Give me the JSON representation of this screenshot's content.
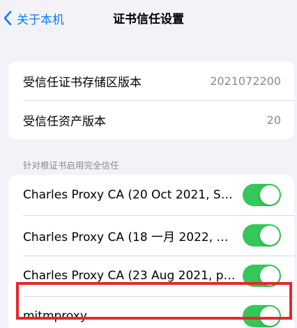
{
  "nav": {
    "back_label": "关于本机",
    "title": "证书信任设置"
  },
  "info": {
    "items": [
      {
        "label": "受信任证书存储区版本",
        "value": "2021072200"
      },
      {
        "label": "受信任资产版本",
        "value": "20"
      }
    ]
  },
  "trust": {
    "header": "针对根证书启用完全信任",
    "items": [
      {
        "label": "Charles Proxy CA (20 Oct 2021, SH-...",
        "enabled": true
      },
      {
        "label": "Charles Proxy CA (18 一月 2022, DE...",
        "enabled": true
      },
      {
        "label": "Charles Proxy CA (23 Aug 2021, plut...",
        "enabled": true
      },
      {
        "label": "mitmproxy",
        "enabled": true
      }
    ]
  },
  "colors": {
    "accent": "#0a7aff",
    "toggle_on": "#34c759",
    "highlight": "#e8262c",
    "background": "#f2f2f7"
  }
}
